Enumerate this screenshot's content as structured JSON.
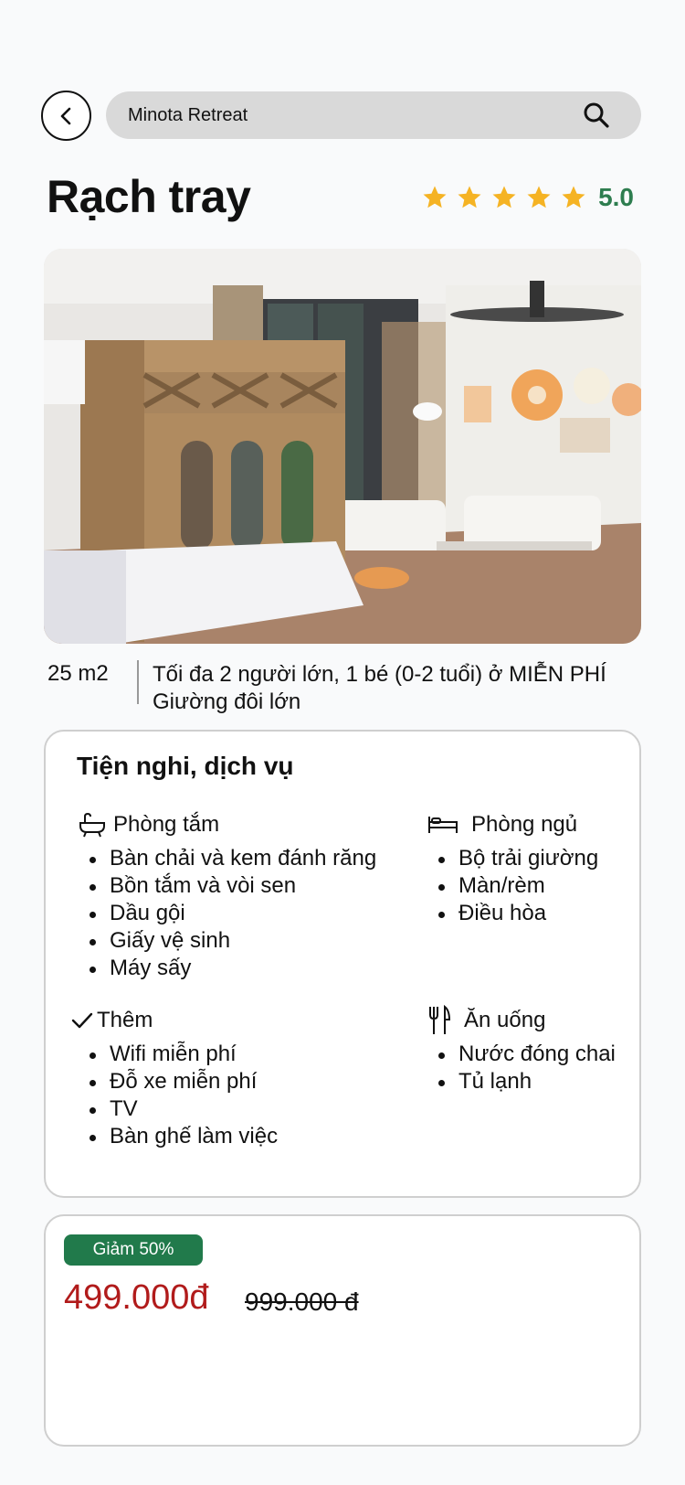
{
  "search": {
    "value": "Minota Retreat"
  },
  "room": {
    "title": "Rạch tray",
    "rating": "5.0",
    "stars": 5,
    "area": "25 m2",
    "occupancy": "Tối đa 2 người lớn, 1 bé (0-2 tuổi) ở MIỄN PHÍ",
    "bed": "Giường đôi lớn"
  },
  "amenities": {
    "title": "Tiện nghi, dịch vụ",
    "bathroom": {
      "icon": "bathtub-icon",
      "label": "Phòng tắm",
      "items": [
        "Bàn chải và kem đánh răng",
        "Bồn tắm và vòi sen",
        "Dầu gội",
        "Giấy vệ sinh",
        "Máy sấy"
      ]
    },
    "bedroom": {
      "icon": "bed-icon",
      "label": "Phòng ngủ",
      "items": [
        "Bộ trải giường",
        "Màn/rèm",
        "Điều hòa"
      ]
    },
    "extra": {
      "icon": "check-icon",
      "label": "Thêm",
      "items": [
        "Wifi miễn phí",
        "Đỗ xe miễn phí",
        "TV",
        "Bàn ghế làm việc"
      ]
    },
    "dining": {
      "icon": "fork-knife-icon",
      "label": "Ăn uống",
      "items": [
        "Nước đóng chai",
        "Tủ lạnh"
      ]
    }
  },
  "price": {
    "discount": "Giảm 50%",
    "current": "499.000đ",
    "original": "999.000 đ"
  },
  "colors": {
    "star": "#f5b324",
    "rating": "#2e7d4f",
    "badge": "#217a4b",
    "price": "#b11b1b"
  }
}
